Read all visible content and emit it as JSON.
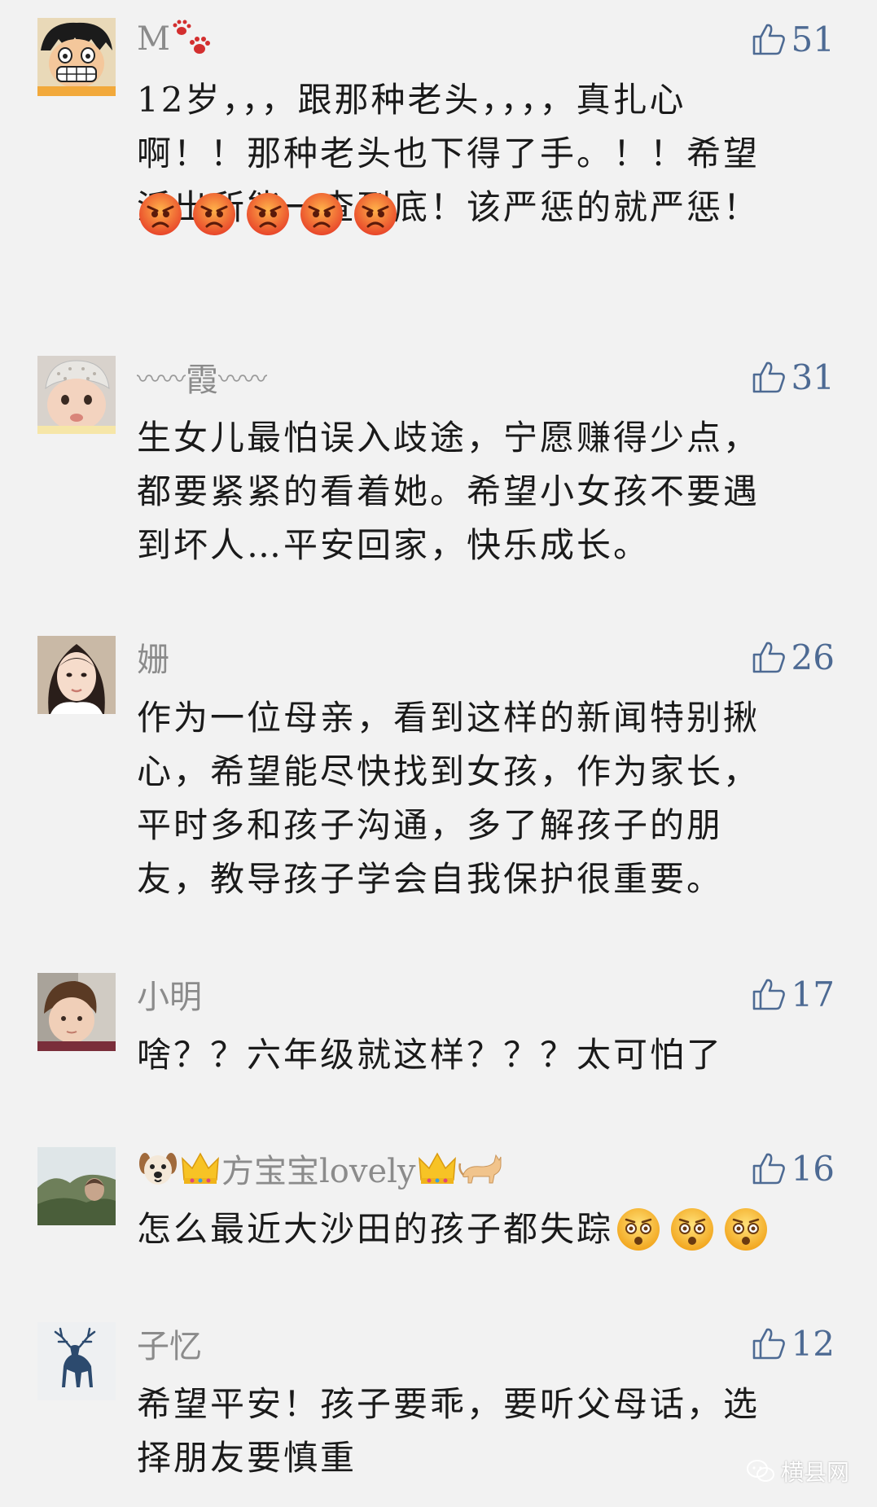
{
  "colors": {
    "background": "#f2f2f2",
    "username": "#8b8b8b",
    "like_accent": "#4d6a93",
    "body_text": "#1a1a1a"
  },
  "comments": [
    {
      "avatar": "cartoon-boy-avatar",
      "name": "M",
      "name_suffix_icon": "paw-prints-icon",
      "likes": "51",
      "lines": [
        "12岁，，，跟那种老头，，，，真扎心",
        "啊！！那种老头也下得了手。！！希望",
        "派出所能一查到底！该严惩的就严惩！"
      ],
      "trailing_emoji": [
        "angry-face-icon",
        "angry-face-icon",
        "angry-face-icon",
        "angry-face-icon",
        "angry-face-icon"
      ]
    },
    {
      "avatar": "baby-avatar",
      "name_prefix": "〰〰",
      "name": "霞",
      "name_suffix": "〰〰",
      "likes": "31",
      "lines": [
        "生女儿最怕误入歧途，宁愿赚得少点，",
        "都要紧紧的看着她。希望小女孩不要遇",
        "到坏人…平安回家，快乐成长。"
      ]
    },
    {
      "avatar": "woman-avatar",
      "name": "姗",
      "likes": "26",
      "lines": [
        "作为一位母亲，看到这样的新闻特别揪",
        "心，希望能尽快找到女孩，作为家长，",
        "平时多和孩子沟通，多了解孩子的朋",
        "友，教导孩子学会自我保护很重要。"
      ]
    },
    {
      "avatar": "child-avatar",
      "name": "小明",
      "likes": "17",
      "lines": [
        "啥？？六年级就这样？？？太可怕了"
      ]
    },
    {
      "avatar": "landscape-avatar",
      "name": "方宝宝lovely",
      "name_prefix_icons": [
        "dog-face-icon",
        "crown-icon"
      ],
      "name_suffix_icons": [
        "crown-icon",
        "cat-icon"
      ],
      "likes": "16",
      "lines": [
        "怎么最近大沙田的孩子都失踪"
      ],
      "inline_emoji": [
        "astonished-face-icon",
        "astonished-face-icon",
        "astonished-face-icon"
      ]
    },
    {
      "avatar": "deer-avatar",
      "name": "子忆",
      "likes": "12",
      "lines": [
        "希望平安！孩子要乖，要听父母话，选",
        "择朋友要慎重"
      ]
    }
  ],
  "watermark": {
    "icon": "wechat-icon",
    "text": "横县网"
  }
}
